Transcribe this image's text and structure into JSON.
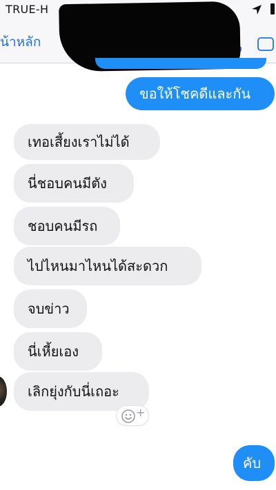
{
  "status_bar": {
    "carrier": "TRUE-H"
  },
  "nav": {
    "back_label": "น้าหลัก"
  },
  "conversation": {
    "outgoing_top": "ขอให้โชคดีและกัน",
    "incoming": [
      "เทอเสี้ยงเราไม่ได้",
      "นี่ชอบคนมีตัง",
      "ชอบคนมีรถ",
      "ไปไหนมาไหนได้สะดวก",
      "จบข่าว",
      "นี่เหี้ยเอง",
      "เลิกยุ่งกับนี่เถอะ"
    ],
    "outgoing_bottom": "คับ"
  },
  "colors": {
    "accent": "#1f8ff7",
    "incoming_bubble": "#ececee",
    "redaction": "#050505"
  },
  "icons": [
    "location-arrow-icon",
    "battery-icon",
    "phone-icon",
    "video-camera-icon",
    "emoji-add-icon"
  ]
}
